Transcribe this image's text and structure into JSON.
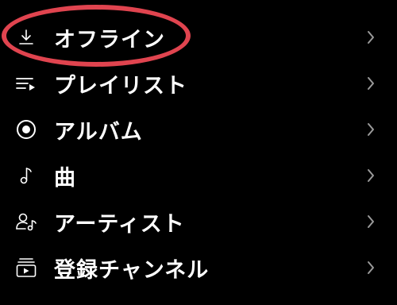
{
  "menu": {
    "items": [
      {
        "label": "オフライン",
        "icon": "download-icon"
      },
      {
        "label": "プレイリスト",
        "icon": "playlist-icon"
      },
      {
        "label": "アルバム",
        "icon": "album-icon"
      },
      {
        "label": "曲",
        "icon": "music-note-icon"
      },
      {
        "label": "アーティスト",
        "icon": "artist-icon"
      },
      {
        "label": "登録チャンネル",
        "icon": "subscriptions-icon"
      }
    ],
    "chevron_icon": "chevron-right-icon"
  },
  "colors": {
    "background": "#000000",
    "text": "#ffffff",
    "chevron": "#9a9a9a",
    "highlight": "#e0444f"
  }
}
